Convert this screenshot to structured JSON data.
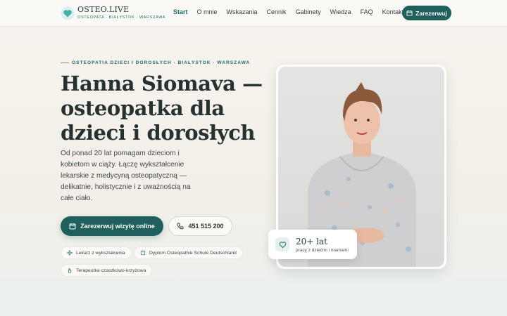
{
  "header": {
    "logo_name": "OSTEO.LIVE",
    "logo_sub": "OSTEOPATA · BIAŁYSTOK · WARSZAWA",
    "nav": [
      {
        "label": "Start",
        "active": true
      },
      {
        "label": "O mnie"
      },
      {
        "label": "Wskazania"
      },
      {
        "label": "Cennik"
      },
      {
        "label": "Gabinety"
      },
      {
        "label": "Wiedza"
      },
      {
        "label": "FAQ"
      },
      {
        "label": "Kontakt"
      }
    ],
    "cta_label": "Zarezerwuj"
  },
  "hero": {
    "eyebrow": "OSTEOPATIA DZIECI I DOROSŁYCH · BIAŁYSTOK · WARSZAWA",
    "title": "Hanna Siomava — osteopatka dla dzieci i dorosłych",
    "lead": "Od ponad 20 lat pomagam dzieciom i kobietom w ciąży. Łączę wykształcenie lekarskie z medycyną osteopatyczną — delikatnie, holistycznie i z uważnością na całe ciało.",
    "cta_label": "Zarezerwuj wizytę online",
    "phone": "451 515 200",
    "chips": [
      {
        "label": "Lekarz z wykształcenia",
        "icon": "sparkle-icon"
      },
      {
        "label": "Dyplom Osteopathie Schule Deutschland",
        "icon": "book-icon"
      },
      {
        "label": "Terapeutka czaszkowo-krzyżowa",
        "icon": "hand-icon"
      }
    ]
  },
  "stat": {
    "value": "20+ lat",
    "label": "pracy z dziećmi i mamami",
    "icon": "heart-icon"
  },
  "colors": {
    "primary": "#1f5f5c",
    "accent": "#1f6f6c",
    "background": "#f7f3ee"
  }
}
